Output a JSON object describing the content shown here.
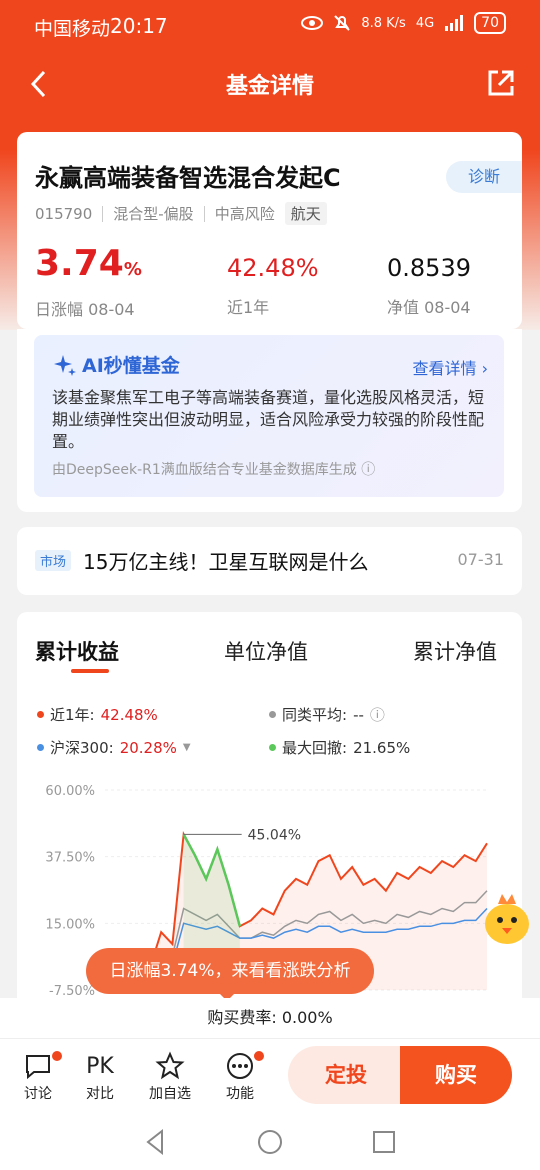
{
  "status": {
    "carrier": "中国移动",
    "time": "20:17",
    "speed": "8.8 K/s",
    "network": "4G",
    "battery": "70"
  },
  "nav": {
    "title": "基金详情"
  },
  "fund": {
    "name": "永赢高端装备智选混合发起C",
    "diagnose_label": "诊断",
    "code": "015790",
    "type": "混合型-偏股",
    "risk": "中高风险",
    "theme": "航天",
    "daily_value": "3.74",
    "daily_unit": "%",
    "daily_label": "日涨幅 08-04",
    "year_value": "42.48%",
    "year_label": "近1年",
    "nav_value": "0.8539",
    "nav_label": "净值 08-04"
  },
  "ai": {
    "title": "AI秒懂基金",
    "link": "查看详情",
    "text": "该基金聚焦军工电子等高端装备赛道，量化选股风格灵活，短期业绩弹性突出但波动明显，适合风险承受力较强的阶段性配置。",
    "source": "由DeepSeek-R1满血版结合专业基金数据库生成"
  },
  "news": {
    "tag": "市场",
    "title": "15万亿主线！卫星互联网是什么",
    "date": "07-31"
  },
  "chart_tabs": [
    "累计收益",
    "单位净值",
    "累计净值"
  ],
  "legend": {
    "year_label": "近1年:",
    "year_value": "42.48%",
    "peer_label": "同类平均:",
    "peer_value": "--",
    "index_label": "沪深300:",
    "index_value": "20.28%",
    "drawdown_label": "最大回撤:",
    "drawdown_value": "21.65%"
  },
  "colors": {
    "fund": "#f0461e",
    "peer": "#999999",
    "index": "#4a90e2",
    "drawdown": "#5ac85a"
  },
  "chart_data": {
    "type": "line",
    "yticks": [
      "60.00%",
      "37.50%",
      "15.00%",
      "-7.50%"
    ],
    "ylim": [
      -7.5,
      60
    ],
    "peak_label": "45.04%",
    "series": [
      {
        "name": "近1年",
        "values": [
          -5,
          -3,
          -6,
          -4,
          0,
          12,
          8,
          45.04,
          38,
          30,
          40,
          28,
          14,
          16,
          20,
          18,
          26,
          30,
          28,
          36,
          38,
          30,
          34,
          28,
          30,
          26,
          32,
          30,
          34,
          32,
          36,
          34,
          38,
          36,
          42
        ]
      },
      {
        "name": "同类平均",
        "values": [
          -6,
          -5,
          -6,
          -5,
          -3,
          5,
          4,
          20,
          18,
          16,
          18,
          14,
          10,
          10,
          12,
          11,
          14,
          16,
          15,
          18,
          19,
          16,
          18,
          15,
          16,
          15,
          18,
          17,
          19,
          18,
          20,
          19,
          22,
          22,
          26
        ]
      },
      {
        "name": "沪深300",
        "values": [
          -6,
          -6,
          -7,
          -6,
          -4,
          2,
          1,
          15,
          14,
          13,
          14,
          12,
          10,
          10,
          11,
          10,
          12,
          13,
          12,
          14,
          14,
          12,
          13,
          12,
          12,
          12,
          13,
          13,
          14,
          14,
          15,
          15,
          16,
          16,
          20
        ]
      }
    ],
    "drawdown_range": [
      7,
      12
    ]
  },
  "tip": "日涨幅3.74%，来看看涨跌分析",
  "fee": {
    "label": "购买费率:",
    "value": "0.00%"
  },
  "bottom": {
    "discuss": "讨论",
    "pk_icon": "PK",
    "compare": "对比",
    "watch": "加自选",
    "func": "功能",
    "sip": "定投",
    "buy": "购买"
  }
}
